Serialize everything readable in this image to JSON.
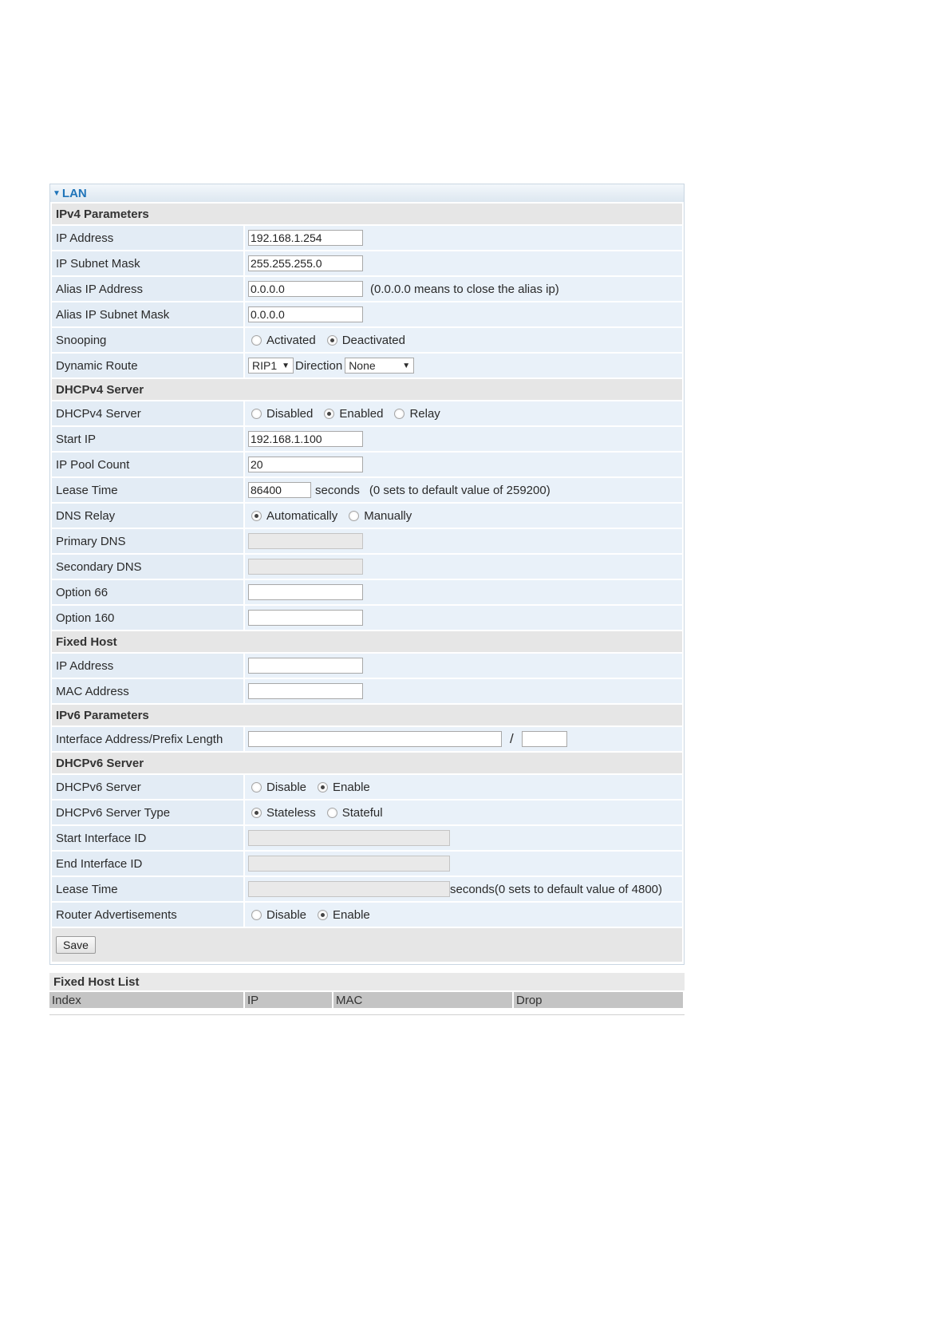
{
  "panel": {
    "title": "LAN"
  },
  "ipv4": {
    "section": "IPv4 Parameters",
    "ip_address": {
      "label": "IP Address",
      "value": "192.168.1.254"
    },
    "subnet_mask": {
      "label": "IP Subnet Mask",
      "value": "255.255.255.0"
    },
    "alias_ip": {
      "label": "Alias IP Address",
      "value": "0.0.0.0",
      "note": "(0.0.0.0 means to close the alias ip)"
    },
    "alias_mask": {
      "label": "Alias IP Subnet Mask",
      "value": "0.0.0.0"
    },
    "snooping": {
      "label": "Snooping",
      "opt1": "Activated",
      "opt2": "Deactivated",
      "selected": "Deactivated"
    },
    "dynamic_route": {
      "label": "Dynamic Route",
      "rip": "RIP1",
      "direction_label": "Direction",
      "direction": "None"
    }
  },
  "dhcpv4": {
    "section": "DHCPv4 Server",
    "server": {
      "label": "DHCPv4 Server",
      "opt1": "Disabled",
      "opt2": "Enabled",
      "opt3": "Relay",
      "selected": "Enabled"
    },
    "start_ip": {
      "label": "Start IP",
      "value": "192.168.1.100"
    },
    "pool_count": {
      "label": "IP Pool Count",
      "value": "20"
    },
    "lease_time": {
      "label": "Lease Time",
      "value": "86400",
      "unit": "seconds",
      "note": "(0 sets to default value of 259200)"
    },
    "dns_relay": {
      "label": "DNS Relay",
      "opt1": "Automatically",
      "opt2": "Manually",
      "selected": "Automatically"
    },
    "primary_dns": {
      "label": "Primary DNS",
      "value": ""
    },
    "secondary_dns": {
      "label": "Secondary DNS",
      "value": ""
    },
    "option66": {
      "label": "Option 66",
      "value": ""
    },
    "option160": {
      "label": "Option 160",
      "value": ""
    }
  },
  "fixed_host": {
    "section": "Fixed Host",
    "ip": {
      "label": "IP Address",
      "value": ""
    },
    "mac": {
      "label": "MAC Address",
      "value": ""
    }
  },
  "ipv6": {
    "section": "IPv6 Parameters",
    "iface": {
      "label": "Interface Address/Prefix Length",
      "value": "",
      "slash": "/",
      "prefix": ""
    }
  },
  "dhcpv6": {
    "section": "DHCPv6 Server",
    "server": {
      "label": "DHCPv6 Server",
      "opt1": "Disable",
      "opt2": "Enable",
      "selected": "Enable"
    },
    "server_type": {
      "label": "DHCPv6 Server Type",
      "opt1": "Stateless",
      "opt2": "Stateful",
      "selected": "Stateless"
    },
    "start_id": {
      "label": "Start Interface ID",
      "value": ""
    },
    "end_id": {
      "label": "End Interface ID",
      "value": ""
    },
    "lease_time": {
      "label": "Lease Time",
      "value": "",
      "note": "seconds(0 sets to default value of 4800)"
    },
    "router_adv": {
      "label": "Router Advertisements",
      "opt1": "Disable",
      "opt2": "Enable",
      "selected": "Enable"
    }
  },
  "actions": {
    "save": "Save"
  },
  "fixed_host_list": {
    "title": "Fixed Host List",
    "columns": [
      "Index",
      "IP",
      "MAC",
      "Drop"
    ]
  }
}
